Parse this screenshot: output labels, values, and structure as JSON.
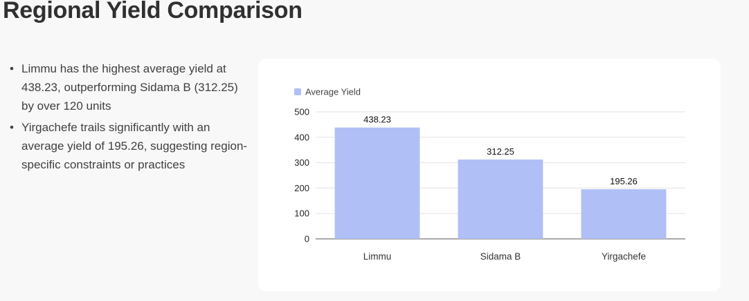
{
  "page": {
    "title": "Regional Yield Comparison"
  },
  "insights": [
    "Limmu has the highest average yield at 438.23, outperforming Sidama B (312.25) by over 120 units",
    "Yirgachefe trails significantly with an average yield of 195.26, suggesting region-specific constraints or practices"
  ],
  "chart_data": {
    "type": "bar",
    "title": "",
    "xlabel": "",
    "ylabel": "",
    "categories": [
      "Limmu",
      "Sidama B",
      "Yirgachefe"
    ],
    "series": [
      {
        "name": "Average Yield",
        "values": [
          438.23,
          312.25,
          195.26
        ],
        "color": "#b0bff5"
      }
    ],
    "data_labels": [
      "438.23",
      "312.25",
      "195.26"
    ],
    "ylim": [
      0,
      500
    ],
    "yticks": [
      0,
      100,
      200,
      300,
      400,
      500
    ],
    "grid": true,
    "legend": "top-left"
  }
}
